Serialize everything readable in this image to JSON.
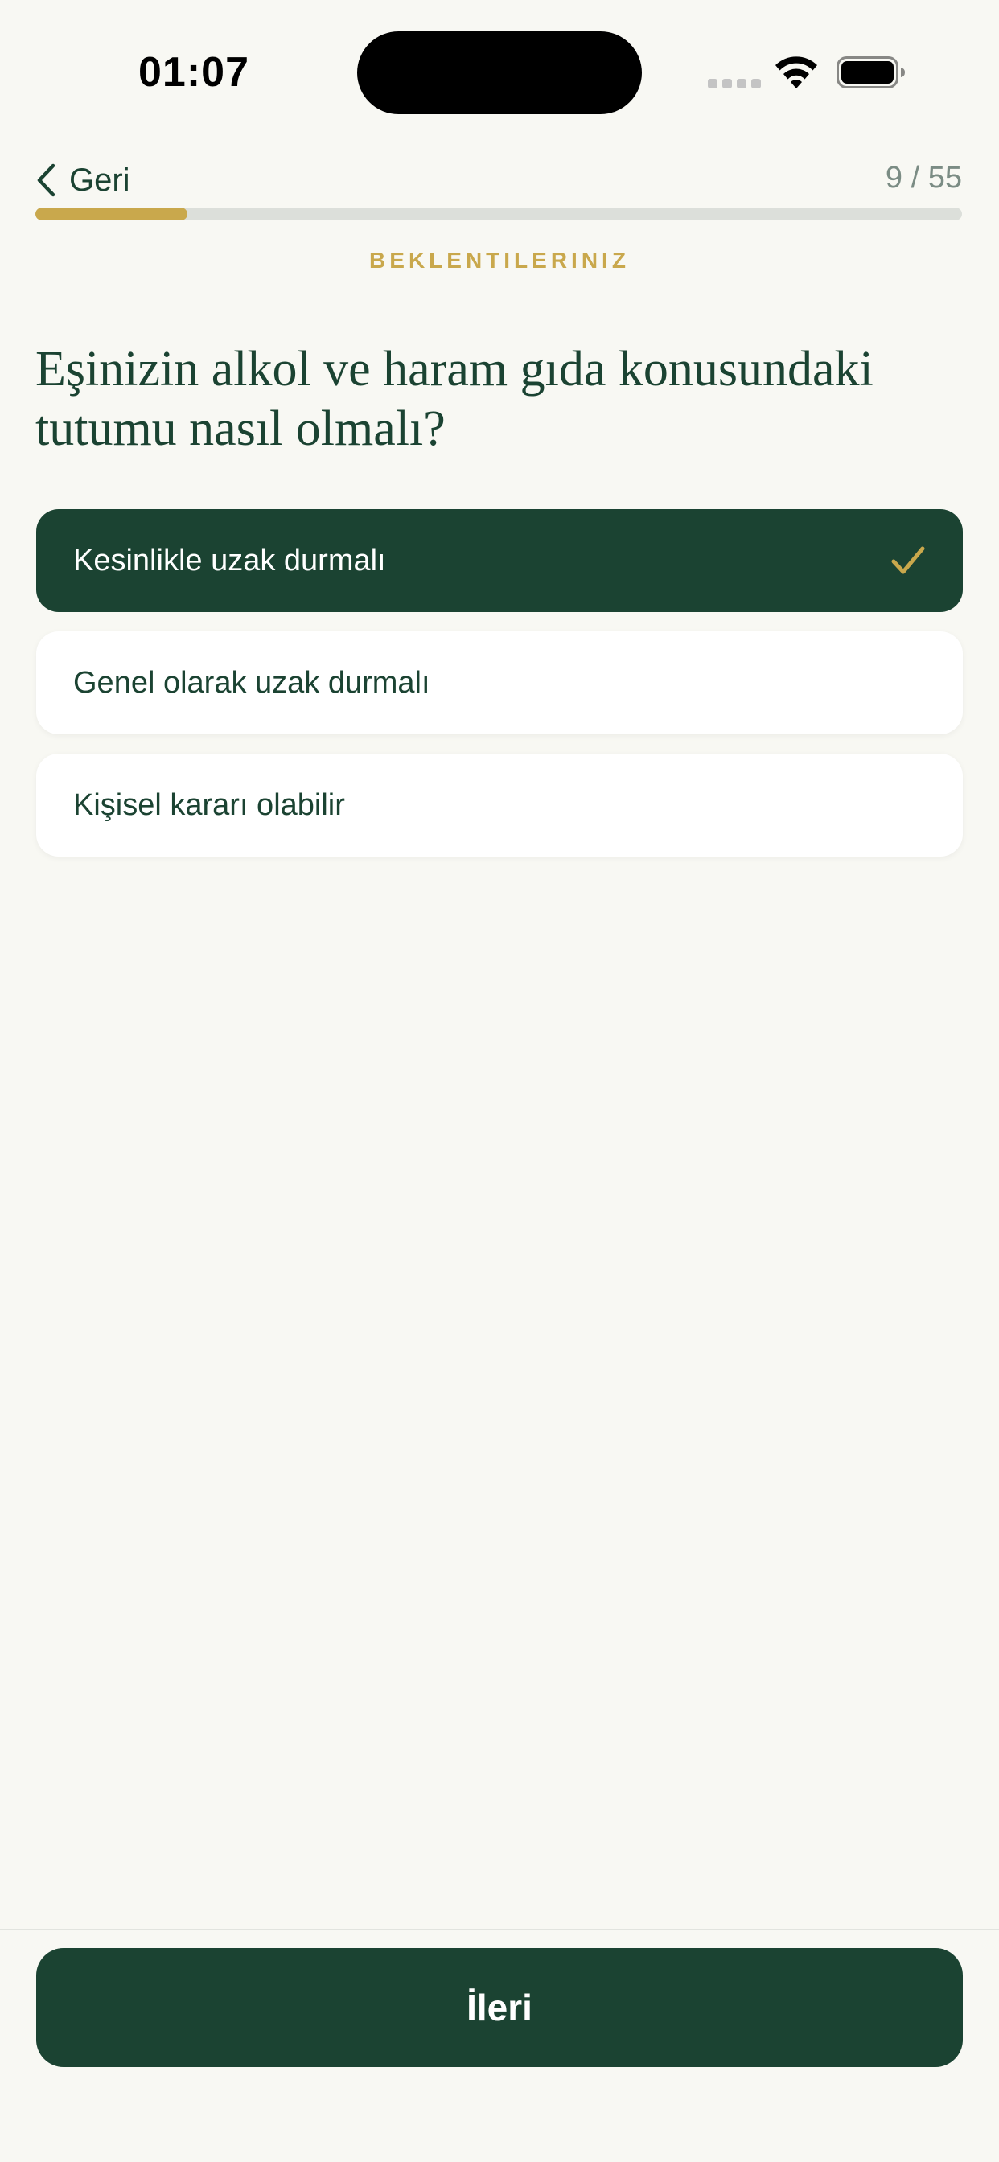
{
  "status_bar": {
    "time": "01:07"
  },
  "header": {
    "back_label": "Geri",
    "progress_text": "9 / 55",
    "progress": {
      "current": 9,
      "total": 55
    }
  },
  "section_label": "BEKLENTILERINIZ",
  "question": "Eşinizin alkol ve haram gıda konusundaki tutumu nasıl olmalı?",
  "options": [
    {
      "label": "Kesinlikle uzak durmalı",
      "selected": true
    },
    {
      "label": "Genel olarak uzak durmalı",
      "selected": false
    },
    {
      "label": "Kişisel kararı olabilir",
      "selected": false
    }
  ],
  "next_label": "İleri",
  "colors": {
    "primary": "#1b4332",
    "accent": "#c9a84c",
    "background": "#f8f8f3",
    "muted": "#7b8c84"
  }
}
